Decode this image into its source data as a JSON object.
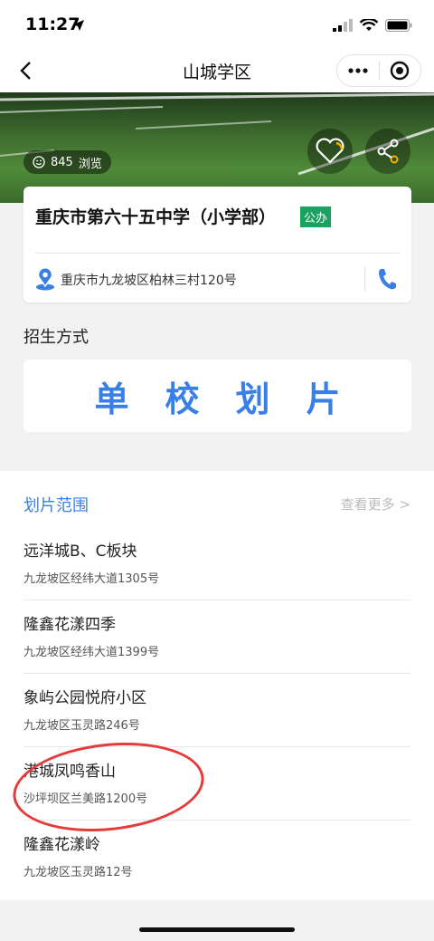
{
  "status_bar": {
    "time": "11:27"
  },
  "nav": {
    "title": "山城学区"
  },
  "hero": {
    "views_count": "845",
    "views_label": "浏览"
  },
  "school": {
    "name": "重庆市第六十五中学（小学部）",
    "type_badge": "公办",
    "address": "重庆市九龙坡区柏林三村120号"
  },
  "enrollment": {
    "section_title": "招生方式",
    "method": "单校划片"
  },
  "zone": {
    "title": "划片范围",
    "view_more": "查看更多 >",
    "items": [
      {
        "name": "远洋城B、C板块",
        "address": "九龙坡区经纬大道1305号"
      },
      {
        "name": "隆鑫花漾四季",
        "address": "九龙坡区经纬大道1399号"
      },
      {
        "name": "象屿公园悦府小区",
        "address": "九龙坡区玉灵路246号"
      },
      {
        "name": "港城凤鸣香山",
        "address": "沙坪坝区兰美路1200号"
      },
      {
        "name": "隆鑫花漾岭",
        "address": "九龙坡区玉灵路12号"
      }
    ]
  },
  "colors": {
    "accent": "#3a7fe5",
    "badge": "#1aa260",
    "annotation": "#e53b3b"
  }
}
